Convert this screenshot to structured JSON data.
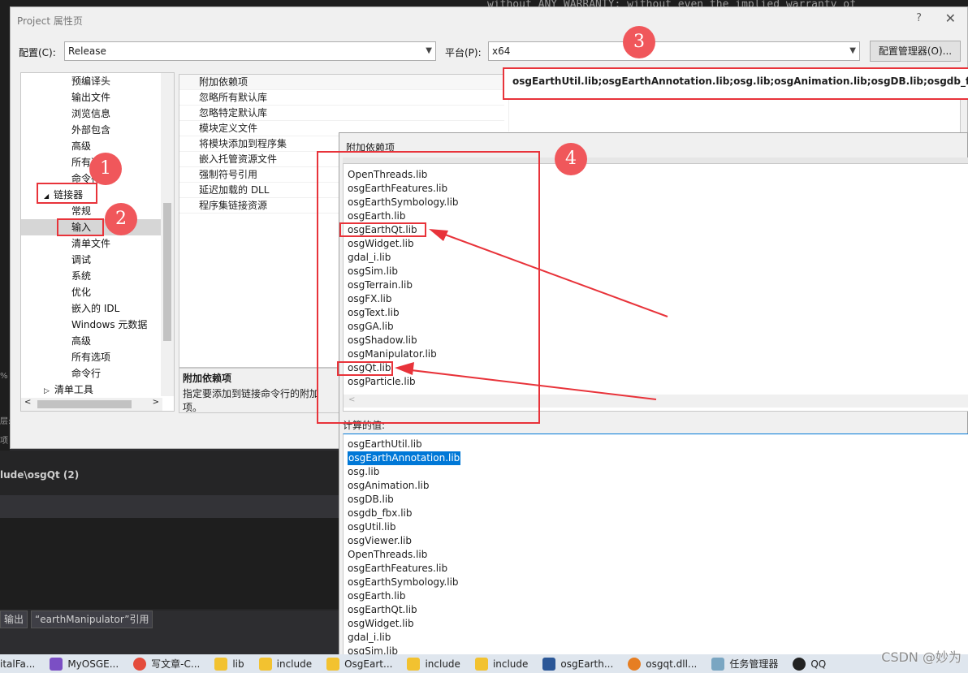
{
  "background": {
    "code_text": "without ANY WARRANTY; without even the implied warranty of",
    "left_strip": [
      "%",
      "层:",
      "项"
    ],
    "panel_header": "lude\\osgQt  (2)",
    "bottom_tabs": [
      "输出",
      "“earthManipulator”引用"
    ]
  },
  "dialog": {
    "title": "Project 属性页",
    "help": "?",
    "close": "✕",
    "config_label": "配置(C):",
    "config_value": "Release",
    "platform_label": "平台(P):",
    "platform_value": "x64",
    "config_manager": "配置管理器(O)..."
  },
  "tree": {
    "items": [
      {
        "label": "预编译头"
      },
      {
        "label": "输出文件"
      },
      {
        "label": "浏览信息"
      },
      {
        "label": "外部包含"
      },
      {
        "label": "高级"
      },
      {
        "label": "所有选项"
      },
      {
        "label": "命令行"
      },
      {
        "label": "链接器",
        "expanded_glyph": "◢"
      },
      {
        "label": "常规"
      },
      {
        "label": "输入"
      },
      {
        "label": "清单文件"
      },
      {
        "label": "调试"
      },
      {
        "label": "系统"
      },
      {
        "label": "优化"
      },
      {
        "label": "嵌入的 IDL"
      },
      {
        "label": "Windows 元数据"
      },
      {
        "label": "高级"
      },
      {
        "label": "所有选项"
      },
      {
        "label": "命令行"
      },
      {
        "label": "清单工具",
        "collapsed_glyph": "▷"
      }
    ]
  },
  "grid": {
    "rows": [
      "附加依赖项",
      "忽略所有默认库",
      "忽略特定默认库",
      "模块定义文件",
      "将模块添加到程序集",
      "嵌入托管资源文件",
      "强制符号引用",
      "延迟加载的 DLL",
      "程序集链接资源"
    ],
    "value": "osgEarthUtil.lib;osgEarthAnnotation.lib;osg.lib;osgAnimation.lib;osgDB.lib;osgdb_fbx.lib;osgUtil.lib",
    "desc_title": "附加依赖项",
    "desc_text": "指定要添加到链接命令行的附加项。"
  },
  "inner": {
    "title": "附加依赖项",
    "list": [
      "OpenThreads.lib",
      "osgEarthFeatures.lib",
      "osgEarthSymbology.lib",
      "osgEarth.lib",
      "osgEarthQt.lib",
      "osgWidget.lib",
      "gdal_i.lib",
      "osgSim.lib",
      "osgTerrain.lib",
      "osgFX.lib",
      "osgText.lib",
      "osgGA.lib",
      "osgShadow.lib",
      "osgManipulator.lib",
      "osgQt.lib",
      "osgParticle.lib"
    ],
    "calc_label": "计算的值:",
    "calc_list": [
      "osgEarthUtil.lib",
      "osgEarthAnnotation.lib",
      "osg.lib",
      "osgAnimation.lib",
      "osgDB.lib",
      "osgdb_fbx.lib",
      "osgUtil.lib",
      "osgViewer.lib",
      "OpenThreads.lib",
      "osgEarthFeatures.lib",
      "osgEarthSymbology.lib",
      "osgEarth.lib",
      "osgEarthQt.lib",
      "osgWidget.lib",
      "gdal_i.lib",
      "osgSim.lib"
    ],
    "selected_calc_index": 1
  },
  "badges": [
    "1",
    "2",
    "3",
    "4"
  ],
  "taskbar": {
    "items": [
      {
        "label": "italFa...",
        "icon": "app-icon"
      },
      {
        "label": "MyOSGE...",
        "icon": "visual-studio-icon"
      },
      {
        "label": "写文章-C...",
        "icon": "chrome-icon"
      },
      {
        "label": "lib",
        "icon": "folder-icon"
      },
      {
        "label": "include",
        "icon": "folder-icon"
      },
      {
        "label": "OsgEart...",
        "icon": "folder-icon"
      },
      {
        "label": "include",
        "icon": "folder-icon"
      },
      {
        "label": "include",
        "icon": "folder-icon"
      },
      {
        "label": "osgEarth...",
        "icon": "word-icon"
      },
      {
        "label": "osgqt.dll...",
        "icon": "search-icon"
      },
      {
        "label": "任务管理器",
        "icon": "task-manager-icon"
      },
      {
        "label": "QQ",
        "icon": "qq-icon"
      }
    ],
    "watermark": "CSDN @妙为"
  },
  "colors": {
    "annotation_red": "#e8333a",
    "badge_fill": "#f0575b",
    "selection_blue": "#0078d7"
  }
}
